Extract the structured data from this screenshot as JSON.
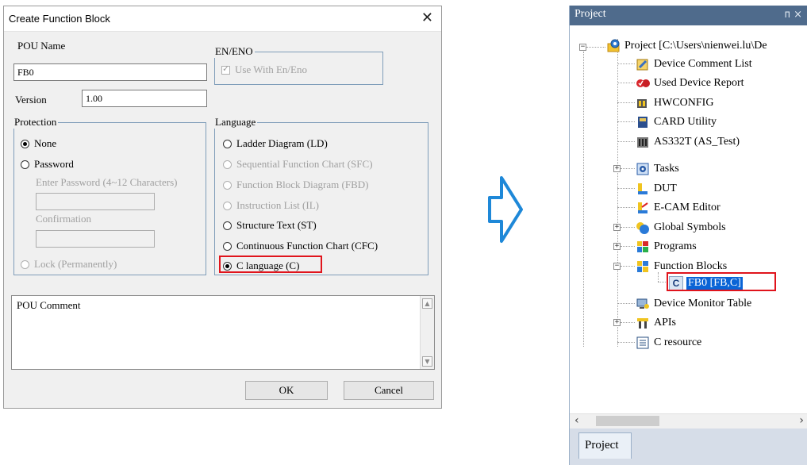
{
  "dialog": {
    "title": "Create Function Block",
    "pou_name_label": "POU Name",
    "pou_name_value": "FB0",
    "version_label": "Version",
    "version_value": "1.00",
    "en_eno_group": "EN/ENO",
    "use_en_eno": "Use With En/Eno",
    "protection_group": "Protection",
    "protection_none": "None",
    "protection_password": "Password",
    "enter_password_label": "Enter Password (4~12 Characters)",
    "confirmation_label": "Confirmation",
    "protection_lock": "Lock (Permanently)",
    "language_group": "Language",
    "languages": [
      "Ladder Diagram (LD)",
      "Sequential Function Chart (SFC)",
      "Function Block Diagram (FBD)",
      "Instruction List (IL)",
      "Structure Text (ST)",
      "Continuous Function Chart (CFC)",
      "C language (C)"
    ],
    "selected_language": "C language (C)",
    "comment_label": "POU Comment",
    "ok_label": "OK",
    "cancel_label": "Cancel"
  },
  "panel": {
    "title": "Project",
    "pin": "ᴨ ×",
    "tab_label": "Project",
    "tree": [
      "Project [C:\\Users\\nienwei.lu\\De",
      "Device Comment List",
      "Used Device Report",
      "HWCONFIG",
      "CARD Utility",
      "AS332T  (AS_Test)",
      "Tasks",
      "DUT",
      "E-CAM Editor",
      "Global Symbols",
      "Programs",
      "Function Blocks",
      "FB0 [FB,C]",
      "Device Monitor Table",
      "APIs",
      "C resource"
    ],
    "selected_item": "FB0 [FB,C]"
  },
  "colors": {
    "highlight_box": "#e0141c",
    "panel_header": "#4f6b8c",
    "selection": "#0a64d6",
    "arrow": "#1e88d8"
  }
}
